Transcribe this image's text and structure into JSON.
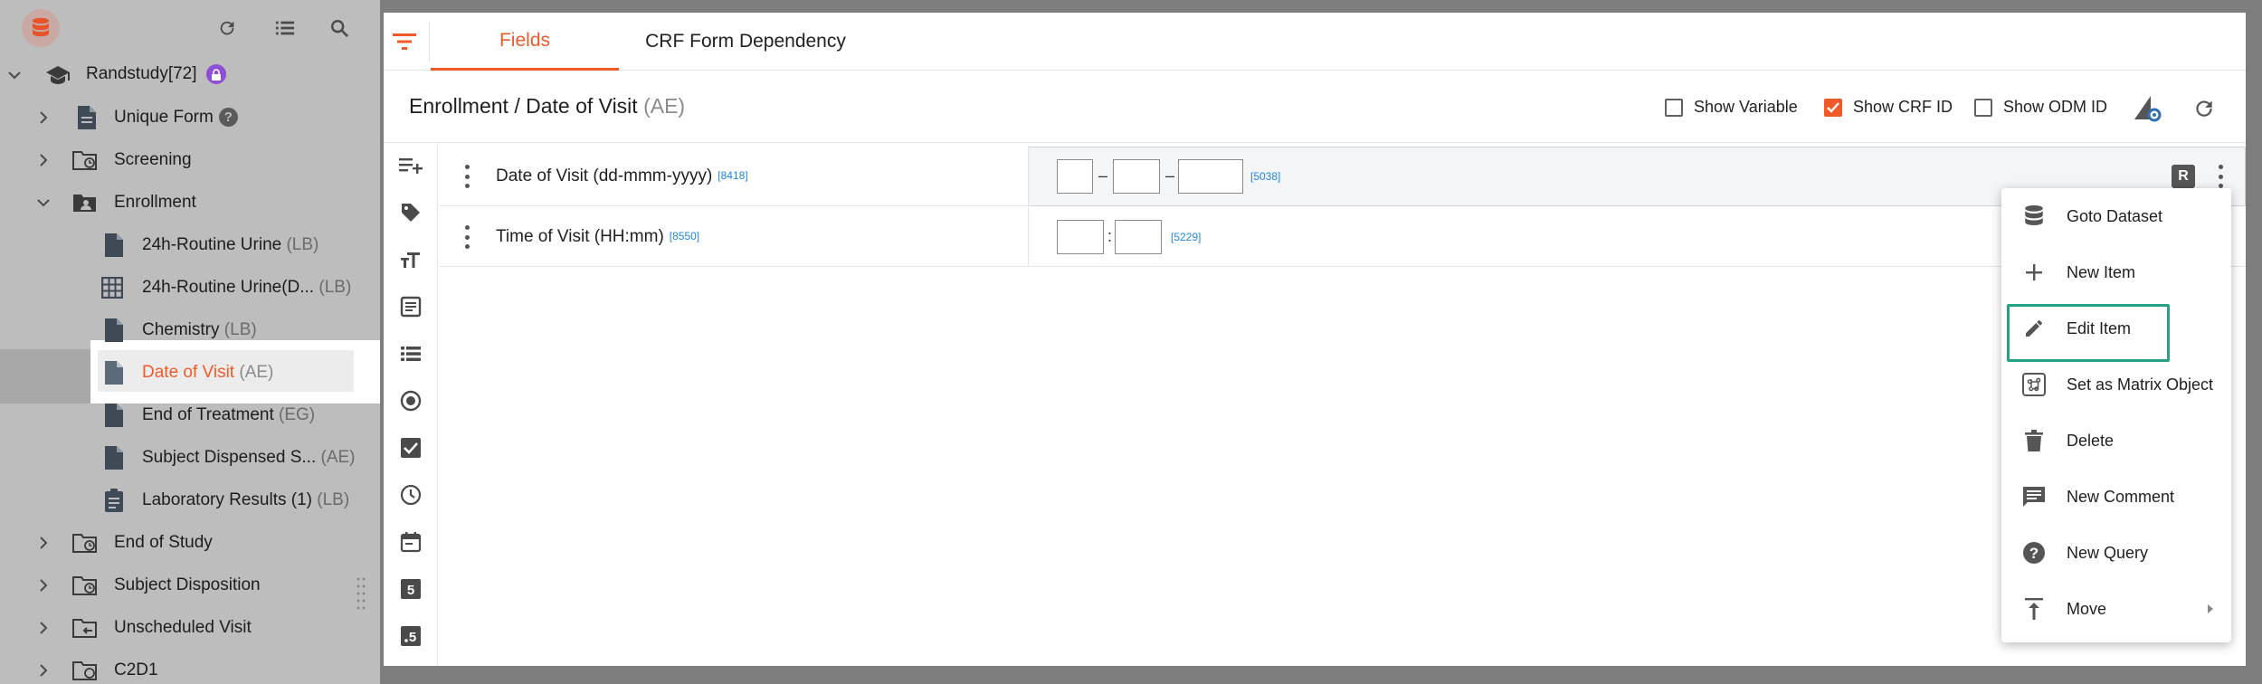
{
  "colors": {
    "accent": "#f05a28",
    "link": "#1e88e5",
    "focus_outline": "#24a384",
    "study_badge": "#8e4fd4"
  },
  "sidebar": {
    "toolbar_icons": [
      "database-icon",
      "refresh-icon",
      "list-icon",
      "search-icon"
    ],
    "study": {
      "label": "Randstudy[72]",
      "icon": "school-icon"
    },
    "items": [
      {
        "label": "Unique Form",
        "suffix": "",
        "icon": "document-icon",
        "help": "?"
      },
      {
        "label": "Screening",
        "suffix": "",
        "icon": "folder-clock-icon"
      },
      {
        "label": "Enrollment",
        "suffix": "",
        "icon": "folder-person-icon"
      },
      {
        "label": "24h-Routine Urine",
        "suffix": "(LB)",
        "icon": "document-icon"
      },
      {
        "label": "24h-Routine Urine(D...",
        "suffix": "(LB)",
        "icon": "table-icon"
      },
      {
        "label": "Chemistry",
        "suffix": "(LB)",
        "icon": "document-icon"
      },
      {
        "label": "Date of Visit",
        "suffix": "(AE)",
        "icon": "document-icon"
      },
      {
        "label": "End of Treatment",
        "suffix": "(EG)",
        "icon": "document-icon"
      },
      {
        "label": "Subject Dispensed S...",
        "suffix": "(AE)",
        "icon": "document-icon"
      },
      {
        "label": "Laboratory Results (1)",
        "suffix": "(LB)",
        "icon": "clipboard-icon"
      },
      {
        "label": "End of Study",
        "suffix": "",
        "icon": "folder-clock-icon"
      },
      {
        "label": "Subject Disposition",
        "suffix": "",
        "icon": "folder-clock-icon"
      },
      {
        "label": "Unscheduled Visit",
        "suffix": "",
        "icon": "folder-return-icon"
      },
      {
        "label": "C2D1",
        "suffix": "",
        "icon": "folder-clock-icon"
      }
    ]
  },
  "tabs": [
    {
      "label": "Fields",
      "active": true
    },
    {
      "label": "CRF Form Dependency",
      "active": false
    }
  ],
  "header": {
    "path": "Enrollment / Date of Visit",
    "suffix": "(AE)",
    "checkboxes": [
      {
        "label": "Show Variable",
        "checked": false
      },
      {
        "label": "Show CRF ID",
        "checked": true
      },
      {
        "label": "Show ODM ID",
        "checked": false
      }
    ]
  },
  "tools": [
    "add-list-icon",
    "tag-icon",
    "text-size-icon",
    "form-icon",
    "list-icon",
    "radio-icon",
    "checkbox-icon",
    "clock-icon",
    "calendar-icon",
    "number-icon",
    "decimal-icon"
  ],
  "items": [
    {
      "label": "Date of Visit (dd-mmm-yyyy)",
      "crf_id": "[8418]",
      "input_id": "[5038]",
      "separator": "–",
      "badge": "R"
    },
    {
      "label": "Time of Visit (HH:mm)",
      "crf_id": "[8550]",
      "input_id": "[5229]",
      "separator": ":"
    }
  ],
  "context_menu": [
    {
      "label": "Goto Dataset",
      "icon": "database-icon"
    },
    {
      "label": "New Item",
      "icon": "plus-icon"
    },
    {
      "label": "Edit Item",
      "icon": "pencil-icon"
    },
    {
      "label": "Set as Matrix Object",
      "icon": "command-icon"
    },
    {
      "label": "Delete",
      "icon": "trash-icon"
    },
    {
      "label": "New Comment",
      "icon": "comment-icon"
    },
    {
      "label": "New Query",
      "icon": "help-circle-icon"
    },
    {
      "label": "Move",
      "icon": "move-top-icon"
    }
  ]
}
